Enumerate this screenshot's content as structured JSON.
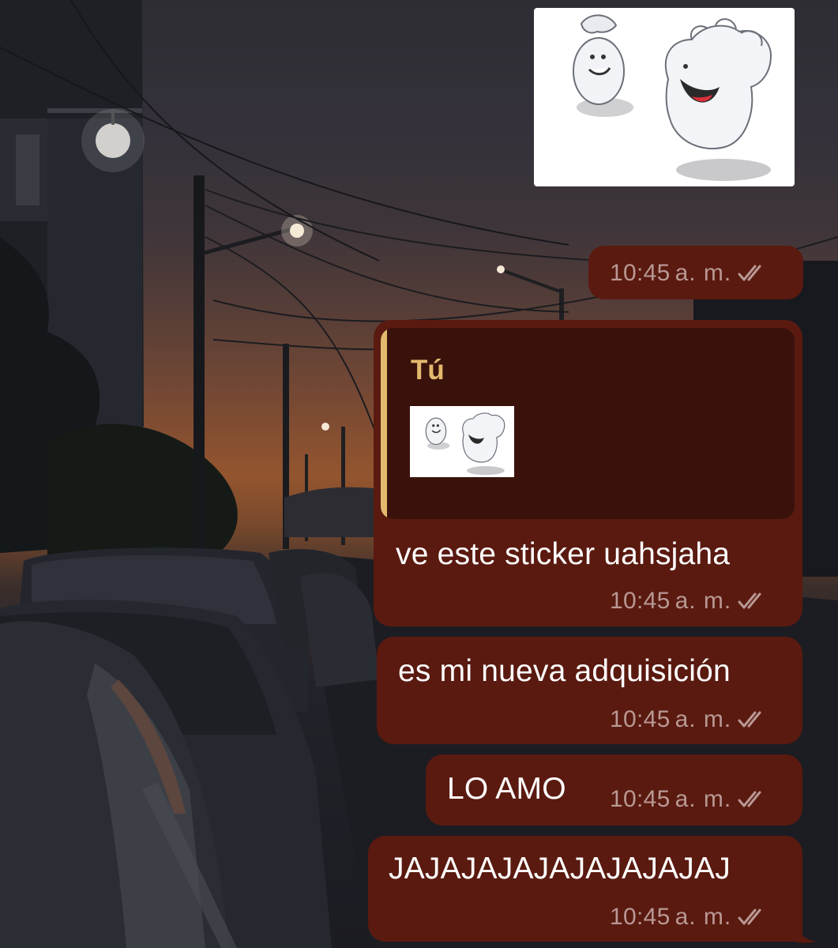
{
  "sticker_message": {
    "time": "10:45",
    "ampm": "a. m."
  },
  "reply_message": {
    "quote_author": "Tú",
    "text": "ve este sticker uahsjaha",
    "time": "10:45",
    "ampm": "a. m."
  },
  "message_2": {
    "text": "es mi nueva adquisición",
    "time": "10:45",
    "ampm": "a. m."
  },
  "message_3": {
    "text": "LO AMO",
    "time": "10:45",
    "ampm": "a. m."
  },
  "message_4": {
    "text": "JAJAJAJAJAJAJAJAJAJ",
    "time": "10:45",
    "ampm": "a. m."
  },
  "colors": {
    "bubble": "#5a1a10",
    "quote_background": "#3a120c",
    "quote_accent": "#e3b96e",
    "meta_text": "#b99893"
  },
  "icons": {
    "read_receipt": "double-check-icon",
    "sticker": "ghost-sticker-image"
  }
}
